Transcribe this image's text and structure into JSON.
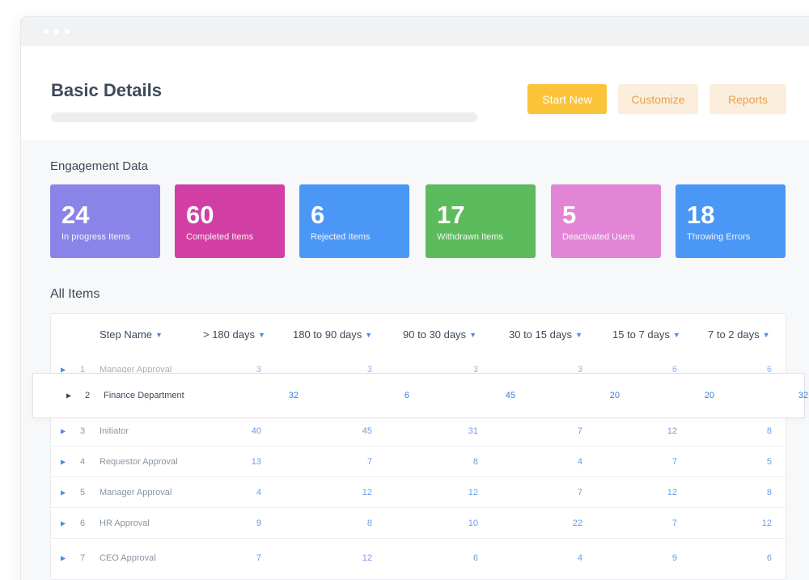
{
  "header": {
    "title": "Basic Details",
    "buttons": {
      "start_new": "Start New",
      "customize": "Customize",
      "reports": "Reports"
    }
  },
  "engagement": {
    "title": "Engagement Data",
    "cards": [
      {
        "value": "24",
        "label": "In progress Items",
        "color": "#8a84e8"
      },
      {
        "value": "60",
        "label": "Completed Items",
        "color": "#d23fa4"
      },
      {
        "value": "6",
        "label": "Rejected Items",
        "color": "#4b97f6"
      },
      {
        "value": "17",
        "label": "Withdrawn Items",
        "color": "#5cbb5c"
      },
      {
        "value": "5",
        "label": "Deactivated Users",
        "color": "#e285d7"
      },
      {
        "value": "18",
        "label": "Throwing Errors",
        "color": "#4a97f5"
      }
    ]
  },
  "items": {
    "title": "All Items",
    "columns": [
      "Step Name",
      "> 180 days",
      "180 to 90 days",
      "90 to 30 days",
      "30 to 15 days",
      "15 to 7 days",
      "7 to 2 days"
    ],
    "rows": [
      {
        "num": "1",
        "name": "Manager Approval",
        "values": [
          "3",
          "3",
          "3",
          "3",
          "6",
          "6"
        ]
      },
      {
        "num": "2",
        "name": "Finance Department",
        "values": [
          "32",
          "6",
          "45",
          "20",
          "20",
          "32"
        ]
      },
      {
        "num": "3",
        "name": "Initiator",
        "values": [
          "40",
          "45",
          "31",
          "7",
          "12",
          "8"
        ]
      },
      {
        "num": "4",
        "name": "Requestor Approval",
        "values": [
          "13",
          "7",
          "8",
          "4",
          "7",
          "5"
        ]
      },
      {
        "num": "5",
        "name": "Manager Approval",
        "values": [
          "4",
          "12",
          "12",
          "7",
          "12",
          "8"
        ]
      },
      {
        "num": "6",
        "name": "HR Approval",
        "values": [
          "9",
          "8",
          "10",
          "22",
          "7",
          "12"
        ]
      },
      {
        "num": "7",
        "name": "CEO Approval",
        "values": [
          "7",
          "12",
          "6",
          "4",
          "9",
          "6"
        ]
      }
    ]
  }
}
